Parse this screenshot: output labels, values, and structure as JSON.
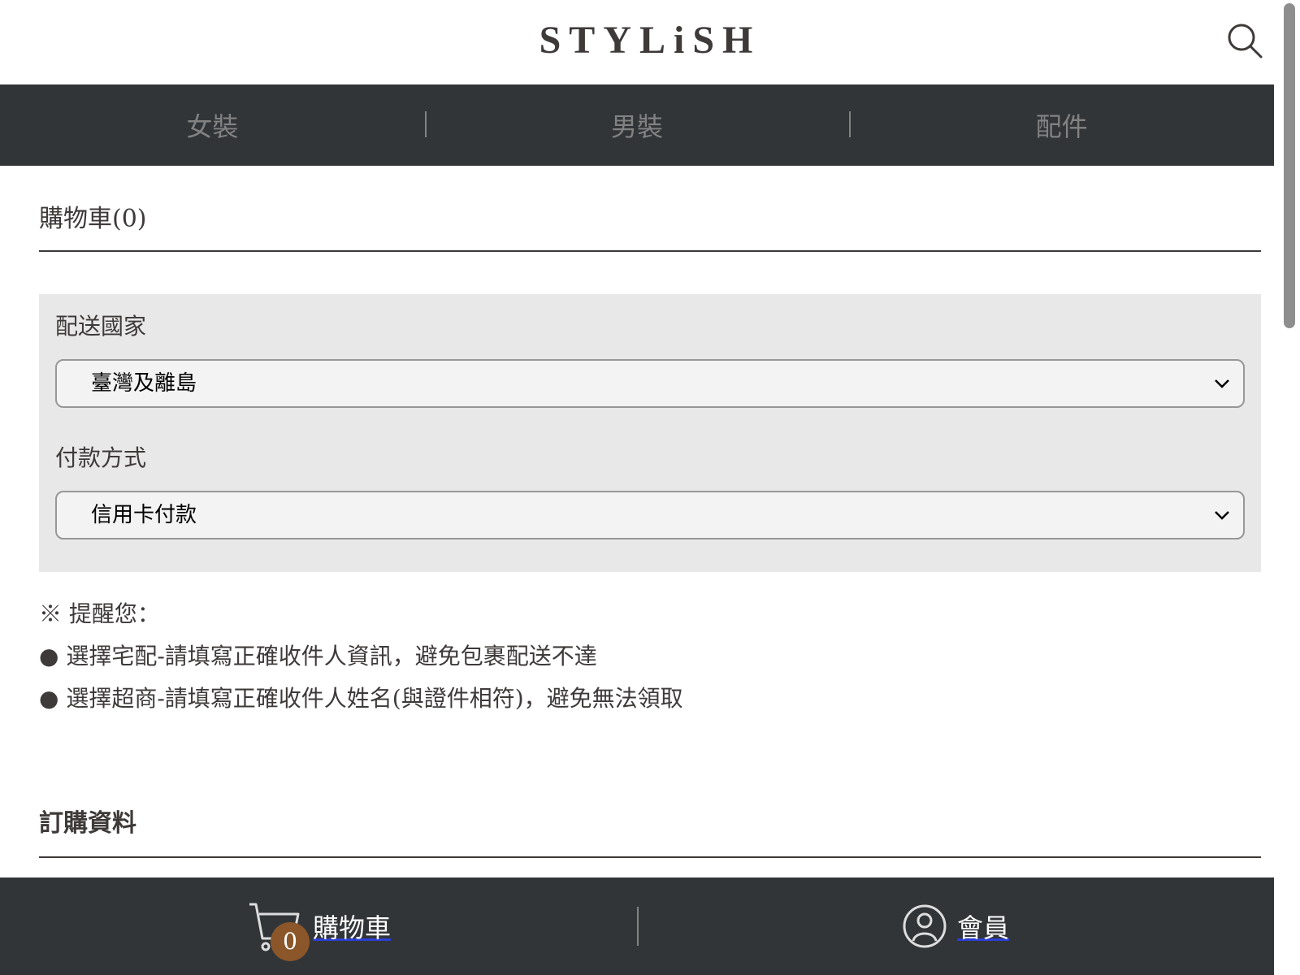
{
  "header": {
    "logo": "STYLiSH",
    "search_icon": "search-icon"
  },
  "nav": {
    "items": [
      "女裝",
      "男裝",
      "配件"
    ]
  },
  "cart": {
    "title": "購物車(0)"
  },
  "options": {
    "country_label": "配送國家",
    "country_value": "臺灣及離島",
    "payment_label": "付款方式",
    "payment_value": "信用卡付款"
  },
  "notice": {
    "heading": "※ 提醒您：",
    "lines": [
      "● 選擇宅配-請填寫正確收件人資訊，避免包裹配送不達",
      "● 選擇超商-請填寫正確收件人姓名(與證件相符)，避免無法領取"
    ]
  },
  "order": {
    "title": "訂購資料"
  },
  "bottom_bar": {
    "cart_label": "購物車",
    "cart_count": "0",
    "member_label": "會員",
    "colors": {
      "background": "#313538",
      "badge": "#8b572a"
    }
  }
}
